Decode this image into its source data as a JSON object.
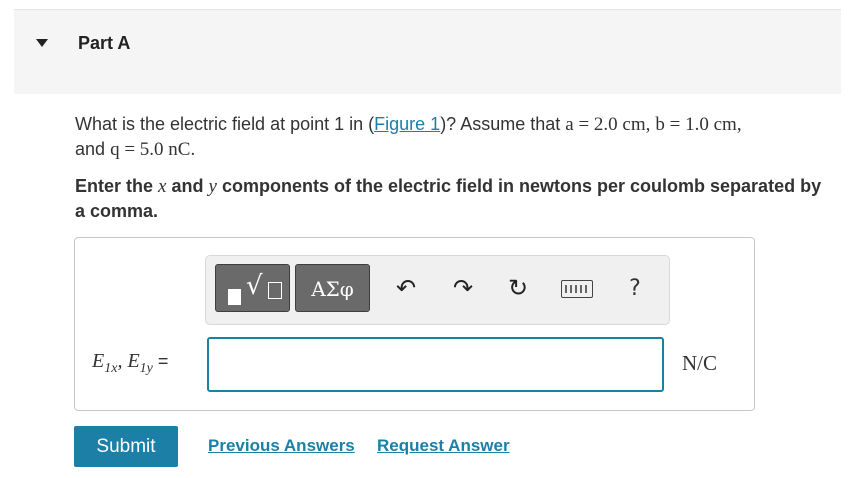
{
  "part": {
    "title": "Part A"
  },
  "question": {
    "prefix": "What is the electric field at point 1 in (",
    "figure_link": "Figure 1",
    "suffix": ")? Assume that",
    "a_value": "a = 2.0 cm,",
    "b_value": "b = 1.0 cm,",
    "and_label": "and",
    "q_value": "q = 5.0 nC."
  },
  "instruction": {
    "p1": "Enter the",
    "x": "x",
    "and": "and",
    "y": "y",
    "p2": "components of the electric field in newtons per coulomb separated by a comma."
  },
  "toolbar": {
    "greek_label": "ΑΣφ",
    "undo_glyph": "↶",
    "redo_glyph": "↷",
    "reset_glyph": "↻",
    "help_label": "?",
    "icons": [
      "templates-icon",
      "greek-icon",
      "undo-icon",
      "redo-icon",
      "reset-icon",
      "keyboard-icon",
      "help-icon"
    ]
  },
  "answer": {
    "label_e1": "E",
    "label_sub1": "1x",
    "label_sep": ", ",
    "label_e2": "E",
    "label_sub2": "1y",
    "equals": " =",
    "value": "",
    "units": "N/C"
  },
  "actions": {
    "submit_label": "Submit",
    "previous_label": "Previous Answers",
    "request_label": "Request Answer"
  },
  "colors": {
    "accent": "#1b7fa6",
    "header_bg": "#f5f5f5",
    "toolbar_btn": "#6a6a6a"
  }
}
